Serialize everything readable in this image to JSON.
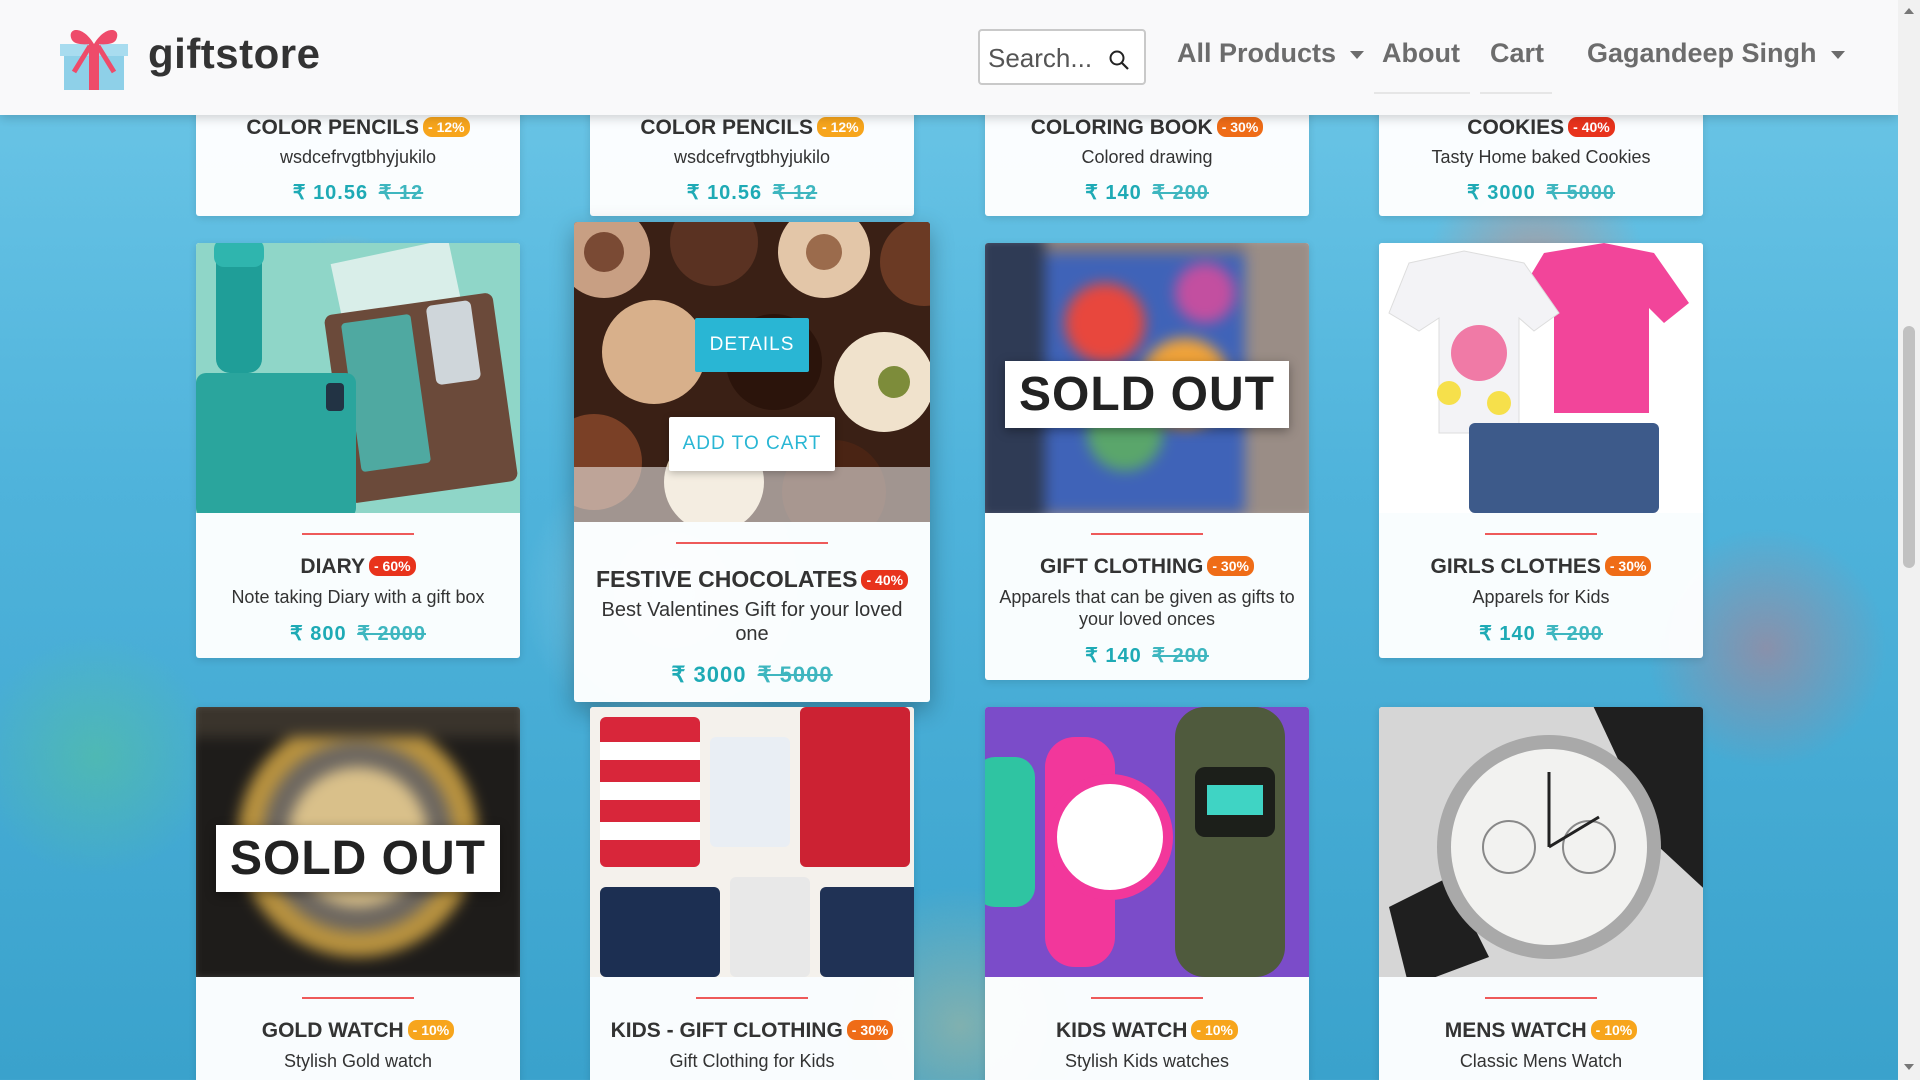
{
  "header": {
    "brand": "giftstore",
    "search_placeholder": "Search...",
    "nav": {
      "all_products": "All Products",
      "about": "About",
      "cart": "Cart",
      "user": "Gagandeep Singh"
    }
  },
  "colors": {
    "accent": "#29b6d4",
    "price": "#1eaab5",
    "divider": "#ee5a5a",
    "badge_orange": "#f7a51c",
    "badge_red": "#e8331c",
    "badge_deep_orange": "#ef6c17"
  },
  "products_top": [
    {
      "name": "COLOR PENCILS",
      "discount": "- 12%",
      "description": "wsdcefrvgtbhyjukilo",
      "price": "₹ 10.56",
      "old_price": "₹ 12"
    },
    {
      "name": "COLOR PENCILS",
      "discount": "- 12%",
      "description": "wsdcefrvgtbhyjukilo",
      "price": "₹ 10.56",
      "old_price": "₹ 12"
    },
    {
      "name": "COLORING BOOK",
      "discount": "- 30%",
      "description": "Colored drawing",
      "price": "₹ 140",
      "old_price": "₹ 200"
    },
    {
      "name": "COOKIES",
      "discount": "- 40%",
      "description": "Tasty Home baked Cookies",
      "price": "₹ 3000",
      "old_price": "₹ 5000"
    }
  ],
  "products_middle": [
    {
      "name": "DIARY",
      "discount": "- 60%",
      "description": "Note taking Diary with a gift box",
      "price": "₹ 800",
      "old_price": "₹ 2000",
      "image": "diary-image"
    },
    {
      "name": "FESTIVE CHOCOLATES",
      "discount": "- 40%",
      "description": "Best Valentines Gift for your loved one",
      "price": "₹ 3000",
      "old_price": "₹ 5000",
      "image": "chocolates-image",
      "details_label": "DETAILS",
      "add_to_cart_label": "ADD TO CART"
    },
    {
      "name": "GIFT CLOTHING",
      "discount": "- 30%",
      "description": "Apparels that can be given as gifts to your loved onces",
      "price": "₹ 140",
      "old_price": "₹ 200",
      "image": "gift-clothing-image",
      "sold_out": "SOLD OUT"
    },
    {
      "name": "GIRLS CLOTHES",
      "discount": "- 30%",
      "description": "Apparels for Kids",
      "price": "₹ 140",
      "old_price": "₹ 200",
      "image": "girls-clothes-image"
    }
  ],
  "products_bottom": [
    {
      "name": "GOLD WATCH",
      "discount": "- 10%",
      "description": "Stylish Gold watch",
      "image": "gold-watch-image",
      "sold_out": "SOLD OUT"
    },
    {
      "name": "KIDS - GIFT CLOTHING",
      "discount": "- 30%",
      "description": "Gift Clothing for Kids",
      "image": "kids-clothing-image"
    },
    {
      "name": "KIDS WATCH",
      "discount": "- 10%",
      "description": "Stylish Kids watches",
      "image": "kids-watch-image"
    },
    {
      "name": "MENS WATCH",
      "discount": "- 10%",
      "description": "Classic Mens Watch",
      "image": "mens-watch-image"
    }
  ]
}
